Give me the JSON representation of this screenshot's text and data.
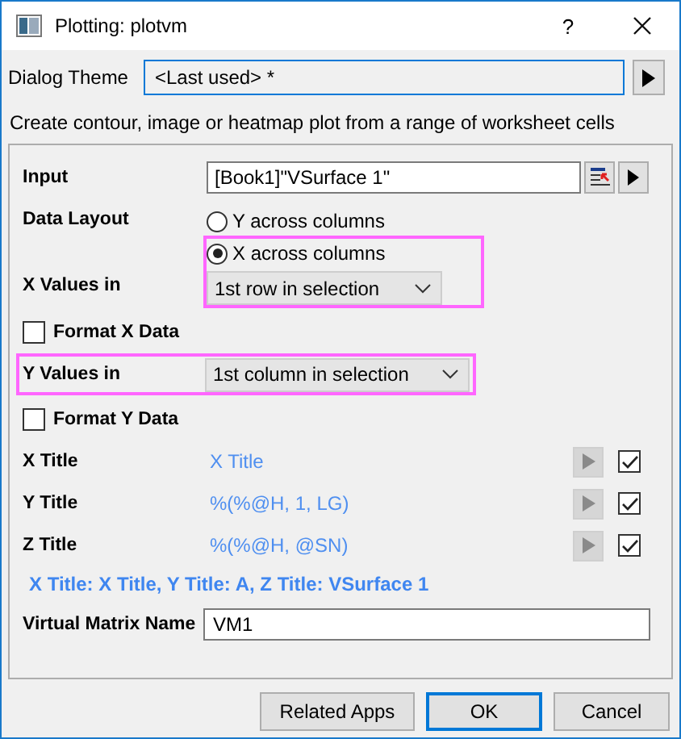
{
  "window": {
    "title": "Plotting: plotvm",
    "help": "?"
  },
  "dialog_theme": {
    "label": "Dialog Theme",
    "value": "<Last used> *"
  },
  "description": "Create contour, image or heatmap plot from a range of worksheet cells",
  "input": {
    "label": "Input",
    "value": "[Book1]\"VSurface 1\""
  },
  "data_layout": {
    "label": "Data Layout",
    "options": [
      {
        "label": "Y across columns",
        "selected": false
      },
      {
        "label": "X across columns",
        "selected": true
      }
    ]
  },
  "x_values": {
    "label": "X Values in",
    "value": "1st row in selection",
    "highlighted": true
  },
  "format_x": {
    "label": "Format X Data",
    "checked": false
  },
  "y_values": {
    "label": "Y Values in",
    "value": "1st column in selection",
    "highlighted": true
  },
  "format_y": {
    "label": "Format Y Data",
    "checked": false
  },
  "titles": [
    {
      "label": "X Title",
      "value": "X Title",
      "checked": true
    },
    {
      "label": "Y Title",
      "value": "%(%@H, 1, LG)",
      "checked": true
    },
    {
      "label": "Z Title",
      "value": "%(%@H, @SN)",
      "checked": true
    }
  ],
  "summary": "X Title: X Title, Y Title: A, Z Title: VSurface 1",
  "matrix_name": {
    "label": "Virtual Matrix Name",
    "value": "VM1"
  },
  "buttons": [
    {
      "label": "Related Apps",
      "default": false
    },
    {
      "label": "OK",
      "default": true
    },
    {
      "label": "Cancel",
      "default": false
    }
  ]
}
